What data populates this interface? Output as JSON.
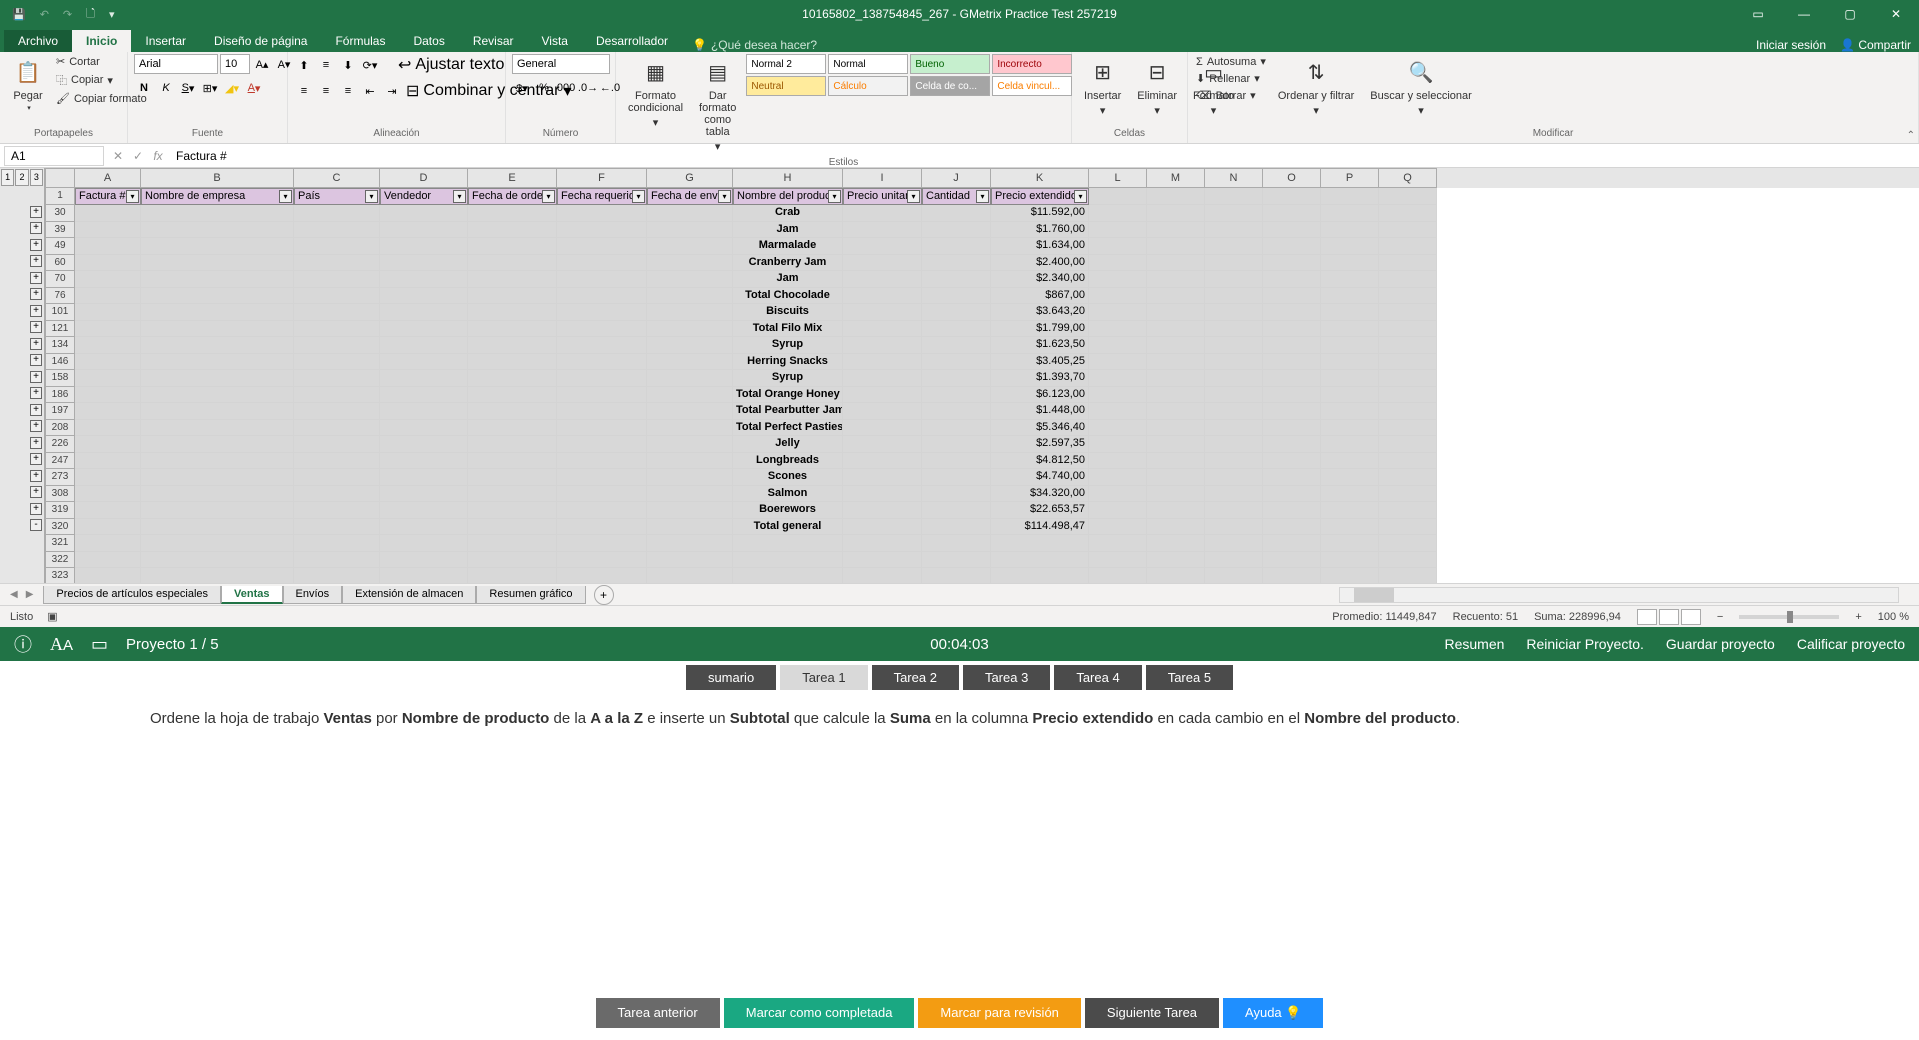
{
  "title": "10165802_138754845_267 - GMetrix Practice Test 257219",
  "titlebar_session": "Iniciar sesión",
  "titlebar_share": "Compartir",
  "menu": {
    "file": "Archivo",
    "tabs": [
      "Inicio",
      "Insertar",
      "Diseño de página",
      "Fórmulas",
      "Datos",
      "Revisar",
      "Vista",
      "Desarrollador"
    ],
    "tellme": "¿Qué desea hacer?"
  },
  "ribbon": {
    "clipboard": {
      "paste": "Pegar",
      "cut": "Cortar",
      "copy": "Copiar",
      "format_painter": "Copiar formato",
      "label": "Portapapeles"
    },
    "font": {
      "name": "Arial",
      "size": "10",
      "label": "Fuente"
    },
    "alignment": {
      "wrap": "Ajustar texto",
      "merge": "Combinar y centrar",
      "label": "Alineación"
    },
    "number": {
      "format": "General",
      "label": "Número"
    },
    "styles": {
      "cond": "Formato condicional",
      "table": "Dar formato como tabla",
      "list": [
        {
          "t": "Normal 2",
          "bg": "#fff",
          "c": "#000"
        },
        {
          "t": "Normal",
          "bg": "#fff",
          "c": "#000"
        },
        {
          "t": "Bueno",
          "bg": "#c6efce",
          "c": "#006100"
        },
        {
          "t": "Incorrecto",
          "bg": "#ffc7ce",
          "c": "#9c0006"
        },
        {
          "t": "Neutral",
          "bg": "#ffeb9c",
          "c": "#9c5700"
        },
        {
          "t": "Cálculo",
          "bg": "#f2f2f2",
          "c": "#fa7d00"
        },
        {
          "t": "Celda de co...",
          "bg": "#a5a5a5",
          "c": "#fff"
        },
        {
          "t": "Celda vincul...",
          "bg": "#fff",
          "c": "#fa7d00"
        }
      ],
      "label": "Estilos"
    },
    "cells": {
      "insert": "Insertar",
      "delete": "Eliminar",
      "format": "Formato",
      "label": "Celdas"
    },
    "editing": {
      "autosum": "Autosuma",
      "fill": "Rellenar",
      "clear": "Borrar",
      "sort": "Ordenar y filtrar",
      "find": "Buscar y seleccionar",
      "label": "Modificar"
    }
  },
  "namebox": "A1",
  "formula": "Factura #",
  "columns": [
    "A",
    "B",
    "C",
    "D",
    "E",
    "F",
    "G",
    "H",
    "I",
    "J",
    "K",
    "L",
    "M",
    "N",
    "O",
    "P",
    "Q"
  ],
  "headers": [
    "Factura #",
    "Nombre de empresa",
    "País",
    "Vendedor",
    "Fecha de orden",
    "Fecha requerida",
    "Fecha de envío",
    "Nombre del producto",
    "Precio unitario",
    "Cantidad",
    "Precio extendido"
  ],
  "rows": [
    {
      "n": "30",
      "btn": "+",
      "h": "Crab",
      "k": "$11.592,00"
    },
    {
      "n": "39",
      "btn": "+",
      "h": "Jam",
      "k": "$1.760,00"
    },
    {
      "n": "49",
      "btn": "+",
      "h": "Marmalade",
      "k": "$1.634,00"
    },
    {
      "n": "60",
      "btn": "+",
      "h": "Cranberry Jam",
      "k": "$2.400,00"
    },
    {
      "n": "70",
      "btn": "+",
      "h": "Jam",
      "k": "$2.340,00"
    },
    {
      "n": "76",
      "btn": "+",
      "h": "Total Chocolade",
      "k": "$867,00"
    },
    {
      "n": "101",
      "btn": "+",
      "h": "Biscuits",
      "k": "$3.643,20"
    },
    {
      "n": "121",
      "btn": "+",
      "h": "Total Filo Mix",
      "k": "$1.799,00"
    },
    {
      "n": "134",
      "btn": "+",
      "h": "Syrup",
      "k": "$1.623,50"
    },
    {
      "n": "146",
      "btn": "+",
      "h": "Herring Snacks",
      "k": "$3.405,25"
    },
    {
      "n": "158",
      "btn": "+",
      "h": "Syrup",
      "k": "$1.393,70"
    },
    {
      "n": "186",
      "btn": "+",
      "h": "Total Orange Honey",
      "k": "$6.123,00"
    },
    {
      "n": "197",
      "btn": "+",
      "h": "Total Pearbutter Jam",
      "k": "$1.448,00"
    },
    {
      "n": "208",
      "btn": "+",
      "h": "Total Perfect Pasties",
      "k": "$5.346,40"
    },
    {
      "n": "226",
      "btn": "+",
      "h": "Jelly",
      "k": "$2.597,35"
    },
    {
      "n": "247",
      "btn": "+",
      "h": "Longbreads",
      "k": "$4.812,50"
    },
    {
      "n": "273",
      "btn": "+",
      "h": "Scones",
      "k": "$4.740,00"
    },
    {
      "n": "308",
      "btn": "+",
      "h": "Salmon",
      "k": "$34.320,00"
    },
    {
      "n": "319",
      "btn": "+",
      "h": "Boerewors",
      "k": "$22.653,57"
    },
    {
      "n": "320",
      "btn": "-",
      "h": "Total general",
      "k": "$114.498,47"
    },
    {
      "n": "321",
      "btn": "",
      "h": "",
      "k": ""
    },
    {
      "n": "322",
      "btn": "",
      "h": "",
      "k": ""
    },
    {
      "n": "323",
      "btn": "",
      "h": "",
      "k": ""
    }
  ],
  "sheets": [
    "Precios de artículos especiales",
    "Ventas",
    "Envíos",
    "Extensión de almacen",
    "Resumen gráfico"
  ],
  "active_sheet": 1,
  "status": {
    "ready": "Listo",
    "avg": "Promedio: 11449,847",
    "count": "Recuento: 51",
    "sum": "Suma: 228996,94",
    "zoom": "100 %"
  },
  "gmetrix": {
    "project": "Proyecto 1 / 5",
    "timer": "00:04:03",
    "links": [
      "Resumen",
      "Reiniciar Proyecto.",
      "Guardar proyecto",
      "Calificar proyecto"
    ]
  },
  "task_tabs": [
    "sumario",
    "Tarea 1",
    "Tarea 2",
    "Tarea 3",
    "Tarea 4",
    "Tarea 5"
  ],
  "active_task": 1,
  "instruction_parts": {
    "p1": "Ordene la hoja de trabajo ",
    "b1": "Ventas",
    "p2": " por ",
    "b2": "Nombre de producto",
    "p3": " de la ",
    "b3": "A a la Z",
    "p4": " e inserte un ",
    "b4": "Subtotal",
    "p5": " que calcule la ",
    "b5": "Suma",
    "p6": " en la columna ",
    "b6": "Precio extendido",
    "p7": " en cada cambio en el ",
    "b7": "Nombre del producto",
    "p8": "."
  },
  "bottom": [
    "Tarea anterior",
    "Marcar como completada",
    "Marcar para revisión",
    "Siguiente Tarea",
    "Ayuda 💡"
  ]
}
